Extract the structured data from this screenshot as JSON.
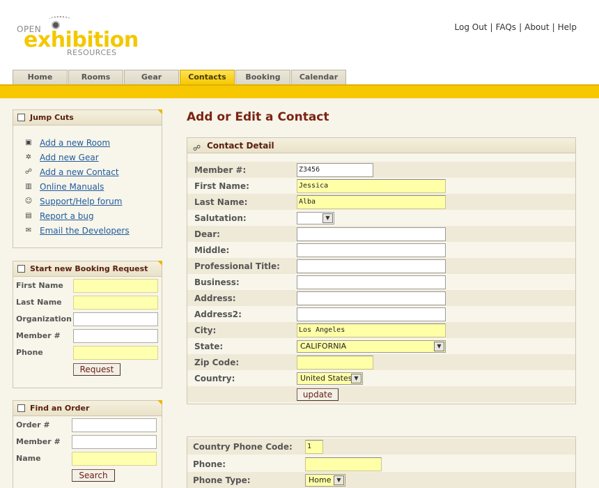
{
  "header": {
    "logo": {
      "line1": "OPEN",
      "line2": "exhibition",
      "line3": "RESOURCES"
    },
    "links": [
      "Log Out",
      "FAQs",
      "About",
      "Help"
    ]
  },
  "tabs": [
    "Home",
    "Rooms",
    "Gear",
    "Contacts",
    "Booking",
    "Calendar"
  ],
  "active_tab": "Contacts",
  "sidebar": {
    "jump_cuts": {
      "title": "Jump Cuts",
      "items": [
        {
          "label": "Add a new Room",
          "icon": "room-icon"
        },
        {
          "label": "Add new Gear",
          "icon": "gear-icon"
        },
        {
          "label": "Add a new Contact",
          "icon": "contacts-icon"
        },
        {
          "label": "Online Manuals",
          "icon": "book-icon"
        },
        {
          "label": "Support/Help forum",
          "icon": "people-icon"
        },
        {
          "label": "Report a bug",
          "icon": "report-icon"
        },
        {
          "label": "Email the Developers",
          "icon": "envelope-icon"
        }
      ]
    },
    "booking": {
      "title": "Start new Booking Request",
      "fields": [
        "First Name",
        "Last Name",
        "Organization",
        "Member #",
        "Phone"
      ],
      "button": "Request"
    },
    "find_order": {
      "title": "Find an Order",
      "fields": [
        "Order #",
        "Member #",
        "Name"
      ],
      "button": "Search"
    }
  },
  "main": {
    "title": "Add or Edit a Contact",
    "contact_detail": {
      "title": "Contact Detail",
      "fields": {
        "member": {
          "label": "Member #:",
          "value": "Z3456"
        },
        "first_name": {
          "label": "First Name:",
          "value": "Jessica"
        },
        "last_name": {
          "label": "Last Name:",
          "value": "Alba"
        },
        "salutation": {
          "label": "Salutation:",
          "value": ""
        },
        "dear": {
          "label": "Dear:",
          "value": ""
        },
        "middle": {
          "label": "Middle:",
          "value": ""
        },
        "professional_title": {
          "label": "Professional Title:",
          "value": ""
        },
        "business": {
          "label": "Business:",
          "value": ""
        },
        "address": {
          "label": "Address:",
          "value": ""
        },
        "address2": {
          "label": "Address2:",
          "value": ""
        },
        "city": {
          "label": "City:",
          "value": "Los Angeles"
        },
        "state": {
          "label": "State:",
          "value": "CALIFORNIA"
        },
        "zip": {
          "label": "Zip Code:",
          "value": ""
        },
        "country": {
          "label": "Country:",
          "value": "United States"
        }
      },
      "button": "update"
    },
    "phone": {
      "country_code": {
        "label": "Country Phone Code:",
        "value": "1"
      },
      "phone": {
        "label": "Phone:",
        "value": ""
      },
      "phone_type": {
        "label": "Phone Type:",
        "value": "Home"
      }
    }
  },
  "colors": {
    "accent": "#f7c800",
    "heading": "#7a2412",
    "link": "#1f5b9e",
    "required": "#ffffa8"
  }
}
